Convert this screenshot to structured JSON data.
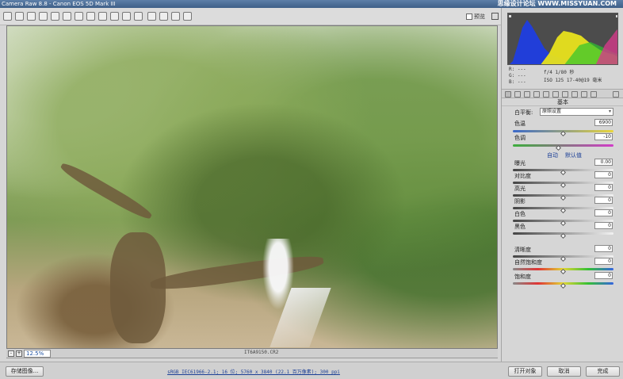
{
  "window": {
    "title": "Camera Raw 8.8  -  Canon EOS 5D Mark III",
    "watermark": "思缘设计论坛 WWW.MISSYUAN.COM"
  },
  "toolbar": {
    "tools": [
      "zoom-icon",
      "hand-icon",
      "white-balance-icon",
      "color-sampler-icon",
      "targeted-adjust-icon",
      "crop-icon",
      "straighten-icon",
      "spot-removal-icon",
      "red-eye-icon",
      "adjustment-brush-icon",
      "graduated-filter-icon",
      "radial-filter-icon",
      "preferences-icon",
      "trash-icon",
      "rotate-left-icon",
      "rotate-right-icon"
    ],
    "preview_label": "预览"
  },
  "status": {
    "zoom_value": "12.5%",
    "filename": "IT6A9150.CR2"
  },
  "bottom": {
    "save_label": "存储图像...",
    "workflow_text": "sRGB IEC61966-2.1; 16 位; 5760 x 3840 (22.1 百万像素); 300 ppi",
    "open_label": "打开对象",
    "cancel_label": "取消",
    "done_label": "完成"
  },
  "exif": {
    "r": "R:  ---",
    "g": "G:  ---",
    "b": "B:  ---",
    "line1": "f/4   1/80 秒",
    "line2": "ISO 125   17-40@19 毫米"
  },
  "panel": {
    "section_title": "基本",
    "white_balance_label": "白平衡:",
    "white_balance_value": "原照设置",
    "temperature_label": "色温",
    "temperature_value": "6900",
    "tint_label": "色调",
    "tint_value": "-10",
    "auto_label": "自动",
    "default_label": "默认值",
    "exposure_label": "曝光",
    "exposure_value": "0.00",
    "contrast_label": "对比度",
    "contrast_value": "0",
    "highlights_label": "高光",
    "highlights_value": "0",
    "shadows_label": "阴影",
    "shadows_value": "0",
    "whites_label": "白色",
    "whites_value": "0",
    "blacks_label": "黑色",
    "blacks_value": "0",
    "clarity_label": "清晰度",
    "clarity_value": "0",
    "vibrance_label": "自然饱和度",
    "vibrance_value": "0",
    "saturation_label": "饱和度",
    "saturation_value": "0"
  },
  "sliders": {
    "temperature": 0.5,
    "tint": 0.46,
    "exposure": 0.5,
    "contrast": 0.5,
    "highlights": 0.5,
    "shadows": 0.5,
    "whites": 0.5,
    "blacks": 0.5,
    "clarity": 0.5,
    "vibrance": 0.5,
    "saturation": 0.5
  },
  "colors": {
    "histogram_blue": "#1f3de0",
    "histogram_yellow": "#e8e21c",
    "histogram_green": "#2ec42e",
    "histogram_red": "#d43a8a"
  }
}
